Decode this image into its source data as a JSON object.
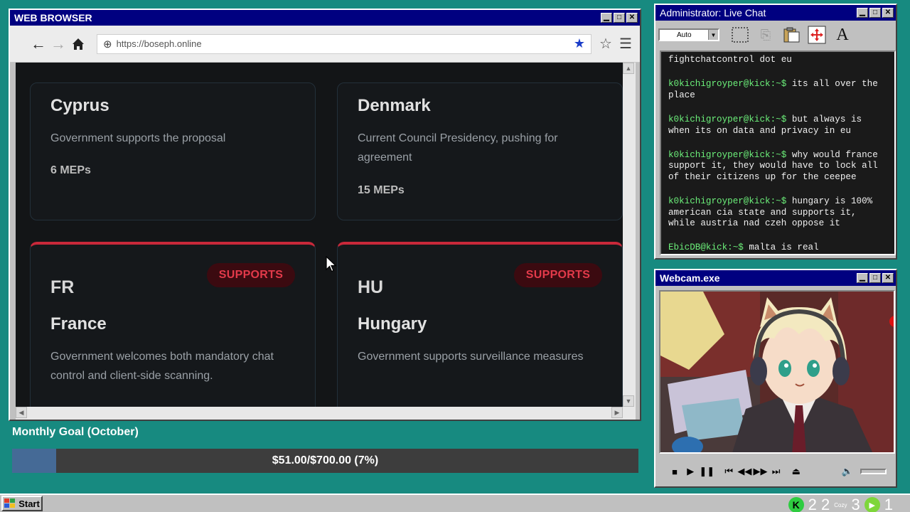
{
  "browser": {
    "title": "WEB BROWSER",
    "url": "https://boseph.online",
    "cards": [
      {
        "name": "Cyprus",
        "desc": "Government supports the proposal",
        "meps": "6 MEPs"
      },
      {
        "name": "Denmark",
        "desc": "Current Council Presidency, pushing for agreement",
        "meps": "15 MEPs"
      },
      {
        "code": "FR",
        "name": "France",
        "badge": "SUPPORTS",
        "desc": "Government welcomes both mandatory chat control and client-side scanning."
      },
      {
        "code": "HU",
        "name": "Hungary",
        "badge": "SUPPORTS",
        "desc": "Government supports surveillance measures"
      }
    ]
  },
  "goal": {
    "title": "Monthly Goal (October)",
    "text": "$51.00/$700.00 (7%)",
    "progress": 0.07
  },
  "chat": {
    "title": "Administrator: Live Chat",
    "font_size": "Auto",
    "messages": [
      {
        "user": "",
        "text": "fightchatcontrol dot eu"
      },
      {
        "user": "k0kichigroyper@kick:~$",
        "text": "its all over the place"
      },
      {
        "user": "k0kichigroyper@kick:~$",
        "text": "but always is when its on data and privacy in eu"
      },
      {
        "user": "k0kichigroyper@kick:~$",
        "text": "why would france support it, they would have to lock all of their citizens up for the ceepee"
      },
      {
        "user": "k0kichigroyper@kick:~$",
        "text": "hungary is 100% american cia state and supports it, while austria nad czeh oppose it"
      },
      {
        "user": "EbicDB@kick:~$",
        "text": "malta is real"
      }
    ]
  },
  "webcam": {
    "title": "Webcam.exe"
  },
  "taskbar": {
    "start": "Start",
    "count1": "2 2",
    "count2": "3",
    "count3": "1",
    "label": "Cozy"
  },
  "colors": {
    "desktop": "#178a80",
    "titlebar": "#000080",
    "support_red": "#c8283a",
    "chat_user": "#6cf07a",
    "goal_fill": "#456a96"
  }
}
